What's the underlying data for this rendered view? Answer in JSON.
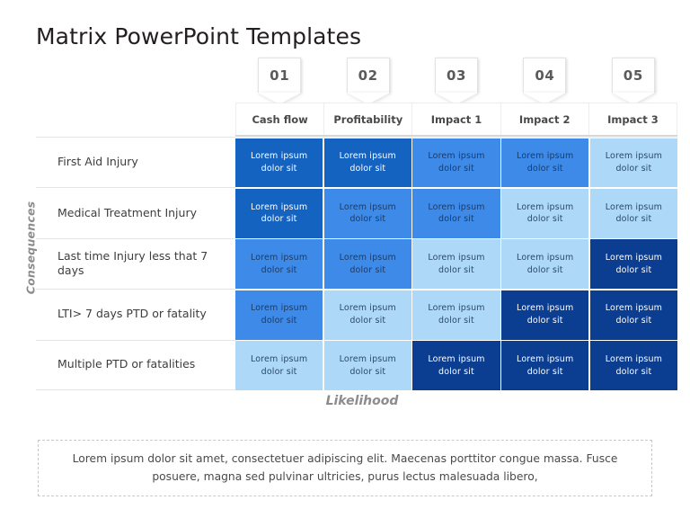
{
  "page_title": "Matrix PowerPoint Templates",
  "axes": {
    "y_label": "Consequences",
    "x_label": "Likelihood"
  },
  "colors": {
    "navy": "#0b3d91",
    "dark_blue": "#1463c0",
    "medium_blue": "#3d8ae8",
    "light_blue": "#aed8f7",
    "header_text": "#4a4a4a",
    "tag_text": "#5a5a5a",
    "axis_label": "#8c8c8c"
  },
  "columns": [
    {
      "number": "01",
      "label": "Cash flow"
    },
    {
      "number": "02",
      "label": "Profitability"
    },
    {
      "number": "03",
      "label": "Impact 1"
    },
    {
      "number": "04",
      "label": "Impact 2"
    },
    {
      "number": "05",
      "label": "Impact 3"
    }
  ],
  "rows": [
    {
      "label": "First Aid Injury",
      "cells": [
        {
          "text_line1": "Lorem  ipsum",
          "text_line2": "dolor sit",
          "level": "dark",
          "bg": "#1463c0",
          "fg": "#ffffff"
        },
        {
          "text_line1": "Lorem  ipsum",
          "text_line2": "dolor sit",
          "level": "dark",
          "bg": "#1463c0",
          "fg": "#ffffff"
        },
        {
          "text_line1": "Lorem  ipsum",
          "text_line2": "dolor sit",
          "level": "medium",
          "bg": "#3d8ae8",
          "fg": "#1b3c66"
        },
        {
          "text_line1": "Lorem  ipsum",
          "text_line2": "dolor sit",
          "level": "medium",
          "bg": "#3d8ae8",
          "fg": "#1b3c66"
        },
        {
          "text_line1": "Lorem  ipsum",
          "text_line2": "dolor sit",
          "level": "light",
          "bg": "#aed8f7",
          "fg": "#29496e"
        }
      ]
    },
    {
      "label": "Medical Treatment Injury",
      "cells": [
        {
          "text_line1": "Lorem  ipsum",
          "text_line2": "dolor sit",
          "level": "dark",
          "bg": "#1463c0",
          "fg": "#ffffff"
        },
        {
          "text_line1": "Lorem  ipsum",
          "text_line2": "dolor sit",
          "level": "medium",
          "bg": "#3d8ae8",
          "fg": "#1b3c66"
        },
        {
          "text_line1": "Lorem  ipsum",
          "text_line2": "dolor sit",
          "level": "medium",
          "bg": "#3d8ae8",
          "fg": "#1b3c66"
        },
        {
          "text_line1": "Lorem  ipsum",
          "text_line2": "dolor sit",
          "level": "light",
          "bg": "#aed8f7",
          "fg": "#29496e"
        },
        {
          "text_line1": "Lorem  ipsum",
          "text_line2": "dolor sit",
          "level": "light",
          "bg": "#aed8f7",
          "fg": "#29496e"
        }
      ]
    },
    {
      "label": "Last time Injury  less that 7 days",
      "cells": [
        {
          "text_line1": "Lorem  ipsum",
          "text_line2": "dolor sit",
          "level": "medium",
          "bg": "#3d8ae8",
          "fg": "#1b3c66"
        },
        {
          "text_line1": "Lorem  ipsum",
          "text_line2": "dolor sit",
          "level": "medium",
          "bg": "#3d8ae8",
          "fg": "#1b3c66"
        },
        {
          "text_line1": "Lorem  ipsum",
          "text_line2": "dolor sit",
          "level": "light",
          "bg": "#aed8f7",
          "fg": "#29496e"
        },
        {
          "text_line1": "Lorem  ipsum",
          "text_line2": "dolor sit",
          "level": "light",
          "bg": "#aed8f7",
          "fg": "#29496e"
        },
        {
          "text_line1": "Lorem  ipsum",
          "text_line2": "dolor sit",
          "level": "navy",
          "bg": "#0b3d91",
          "fg": "#ffffff"
        }
      ]
    },
    {
      "label": "LTI> 7 days PTD or fatality",
      "cells": [
        {
          "text_line1": "Lorem  ipsum",
          "text_line2": "dolor sit",
          "level": "medium",
          "bg": "#3d8ae8",
          "fg": "#1b3c66"
        },
        {
          "text_line1": "Lorem  ipsum",
          "text_line2": "dolor sit",
          "level": "light",
          "bg": "#aed8f7",
          "fg": "#29496e"
        },
        {
          "text_line1": "Lorem  ipsum",
          "text_line2": "dolor sit",
          "level": "light",
          "bg": "#aed8f7",
          "fg": "#29496e"
        },
        {
          "text_line1": "Lorem  ipsum",
          "text_line2": "dolor sit",
          "level": "navy",
          "bg": "#0b3d91",
          "fg": "#ffffff"
        },
        {
          "text_line1": "Lorem  ipsum",
          "text_line2": "dolor sit",
          "level": "navy",
          "bg": "#0b3d91",
          "fg": "#ffffff"
        }
      ]
    },
    {
      "label": "Multiple PTD or fatalities",
      "cells": [
        {
          "text_line1": "Lorem  ipsum",
          "text_line2": "dolor sit",
          "level": "light",
          "bg": "#aed8f7",
          "fg": "#29496e"
        },
        {
          "text_line1": "Lorem  ipsum",
          "text_line2": "dolor sit",
          "level": "light",
          "bg": "#aed8f7",
          "fg": "#29496e"
        },
        {
          "text_line1": "Lorem  ipsum",
          "text_line2": "dolor sit",
          "level": "navy",
          "bg": "#0b3d91",
          "fg": "#ffffff"
        },
        {
          "text_line1": "Lorem  ipsum",
          "text_line2": "dolor sit",
          "level": "navy",
          "bg": "#0b3d91",
          "fg": "#ffffff"
        },
        {
          "text_line1": "Lorem  ipsum",
          "text_line2": "dolor sit",
          "level": "navy",
          "bg": "#0b3d91",
          "fg": "#ffffff"
        }
      ]
    }
  ],
  "footer": {
    "text": "Lorem ipsum dolor sit amet, consectetuer adipiscing elit. Maecenas porttitor congue massa. Fusce posuere, magna sed pulvinar ultricies, purus lectus malesuada libero,"
  }
}
